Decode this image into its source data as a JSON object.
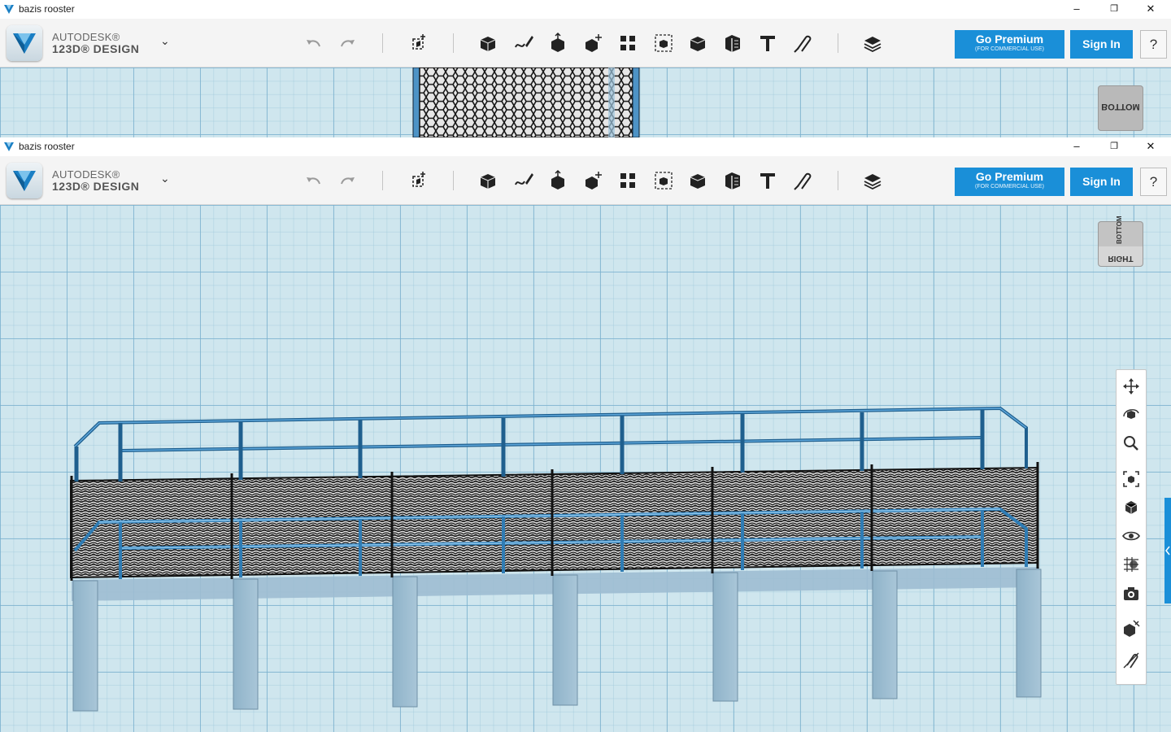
{
  "windows": [
    {
      "title": "bazis rooster",
      "viewcube_labels": [
        "BOTTOM"
      ]
    },
    {
      "title": "bazis rooster",
      "viewcube_labels": [
        "BOTTOM",
        "RIGHT"
      ]
    }
  ],
  "brand": {
    "line1": "AUTODESK®",
    "line2": "123D® DESIGN"
  },
  "window_controls": {
    "minimize": "–",
    "restore": "❐",
    "close": "✕"
  },
  "toolbar": {
    "undo_icon": "undo-icon",
    "redo_icon": "redo-icon",
    "tools": [
      "transform",
      "primitives",
      "sketch",
      "construct",
      "modify",
      "pattern",
      "grouping",
      "combine",
      "measure",
      "text",
      "snap",
      "materials"
    ]
  },
  "premium": {
    "label": "Go Premium",
    "sublabel": "(FOR COMMERCIAL USE)"
  },
  "signin": {
    "label": "Sign In"
  },
  "help": {
    "label": "?"
  },
  "nav_tools": [
    "pan",
    "orbit",
    "zoom",
    "fit",
    "views",
    "visibility",
    "material-view",
    "screenshot",
    "solids-only",
    "snap-toggle"
  ],
  "colors": {
    "accent": "#1a8fd8",
    "grid": "#cfe6ee",
    "model_blue": "#3f8fc9"
  }
}
